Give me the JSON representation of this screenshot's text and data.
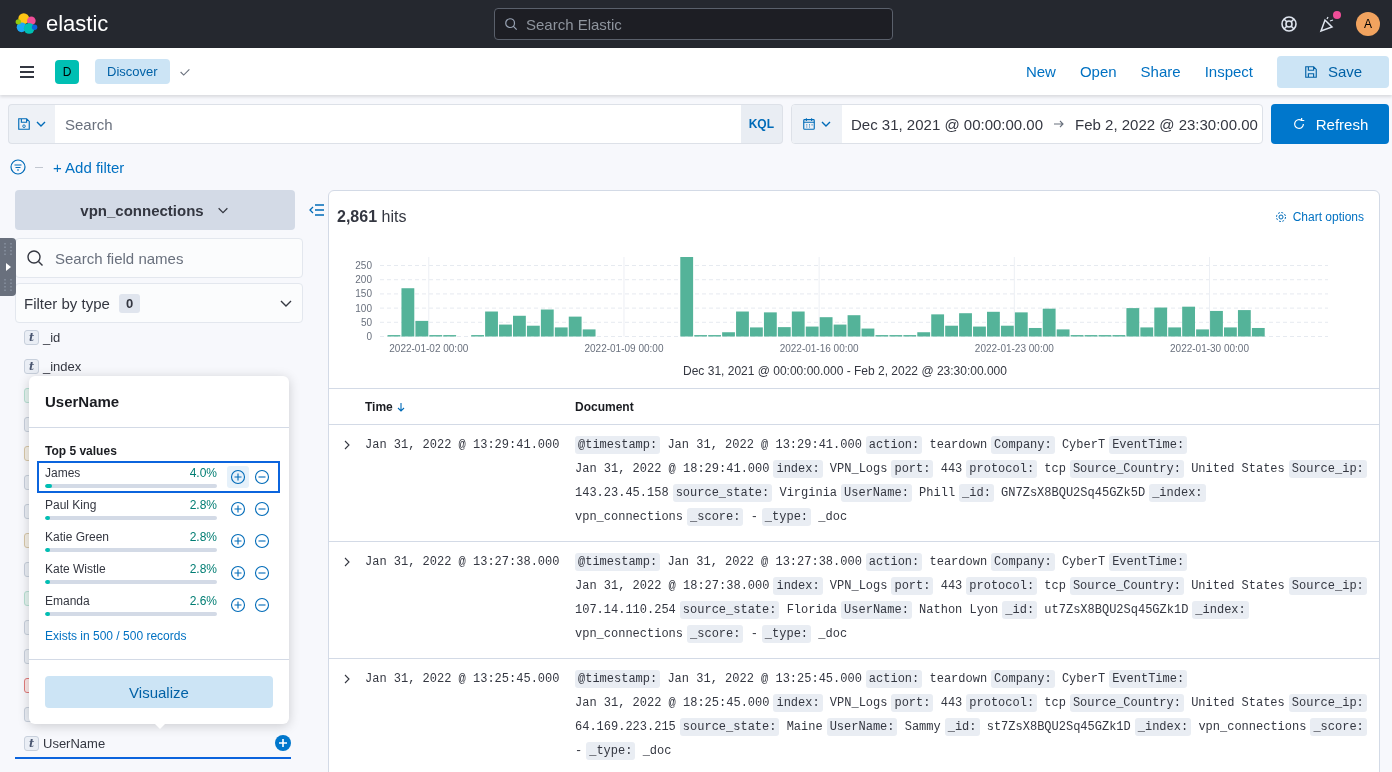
{
  "header": {
    "brand": "elastic",
    "search_placeholder": "Search Elastic",
    "notification": true,
    "avatar": "A"
  },
  "app_bar": {
    "space": "D",
    "breadcrumb": "Discover",
    "links": [
      "New",
      "Open",
      "Share",
      "Inspect"
    ],
    "save": "Save"
  },
  "query_bar": {
    "placeholder": "Search",
    "language": "KQL",
    "start": "Dec 31, 2021 @ 00:00:00.00",
    "end": "Feb 2, 2022 @ 23:30:00.00",
    "refresh": "Refresh"
  },
  "filter_bar": {
    "add_filter": "+ Add filter"
  },
  "sidebar": {
    "index_pattern": "vpn_connections",
    "field_search_placeholder": "Search field names",
    "filter_by_type": "Filter by type",
    "filter_count": "0",
    "fields": [
      {
        "kind": "string",
        "glyph": "t",
        "name": "_id",
        "selected": false
      },
      {
        "kind": "string",
        "glyph": "t",
        "name": "_index",
        "selected": false
      },
      {
        "kind": "number",
        "selected": false
      },
      {
        "kind": "string",
        "selected": false
      },
      {
        "kind": "date",
        "selected": false
      },
      {
        "kind": "string",
        "selected": false
      },
      {
        "kind": "string",
        "selected": false
      },
      {
        "kind": "date",
        "selected": false
      },
      {
        "kind": "string",
        "selected": false
      },
      {
        "kind": "number",
        "selected": false
      },
      {
        "kind": "string",
        "selected": false
      },
      {
        "kind": "string",
        "selected": false
      },
      {
        "kind": "ip",
        "selected": false
      },
      {
        "kind": "string",
        "selected": false
      },
      {
        "kind": "string",
        "glyph": "t",
        "name": "UserName",
        "selected": true
      }
    ]
  },
  "popover": {
    "title": "UserName",
    "subtitle": "Top 5 values",
    "values": [
      {
        "name": "James",
        "percent": "4.0%",
        "level": 0.04,
        "selected": true
      },
      {
        "name": "Paul King",
        "percent": "2.8%",
        "level": 0.028,
        "selected": false
      },
      {
        "name": "Katie Green",
        "percent": "2.8%",
        "level": 0.028,
        "selected": false
      },
      {
        "name": "Kate Wistle",
        "percent": "2.8%",
        "level": 0.028,
        "selected": false
      },
      {
        "name": "Emanda",
        "percent": "2.6%",
        "level": 0.026,
        "selected": false
      }
    ],
    "exists": "Exists in 500 / 500 records",
    "visualize": "Visualize"
  },
  "results": {
    "hits_count": "2,861",
    "hits_label": "hits",
    "chart_options": "Chart options",
    "chart_data": {
      "type": "bar",
      "categories": [
        null,
        null,
        null,
        "2022-01-02 00:00",
        null,
        null,
        null,
        null,
        null,
        null,
        null,
        null,
        null,
        null,
        null,
        null,
        null,
        "2022-01-09 00:00",
        null,
        null,
        null,
        null,
        null,
        null,
        null,
        null,
        null,
        null,
        null,
        null,
        null,
        "2022-01-16 00:00",
        null,
        null,
        null,
        null,
        null,
        null,
        null,
        null,
        null,
        null,
        null,
        null,
        null,
        "2022-01-23 00:00",
        null,
        null,
        null,
        null,
        null,
        null,
        null,
        null,
        null,
        null,
        null,
        null,
        null,
        "2022-01-30 00:00",
        null,
        null,
        null
      ],
      "series": [
        {
          "color": "#54b399",
          "values": [
            5,
            170,
            55,
            5,
            5,
            0,
            5,
            88,
            42,
            73,
            38,
            95,
            32,
            70,
            25,
            0,
            0,
            0,
            0,
            0,
            0,
            280,
            5,
            5,
            15,
            88,
            32,
            85,
            33,
            88,
            35,
            68,
            42,
            75,
            28,
            5,
            5,
            5,
            15,
            78,
            38,
            82,
            35,
            87,
            38,
            85,
            30,
            98,
            25,
            5,
            5,
            5,
            5,
            100,
            32,
            102,
            32,
            105,
            25,
            90,
            32,
            93,
            30
          ]
        }
      ],
      "ylim": [
        0,
        280
      ],
      "grid": true,
      "yticks": [
        0,
        50,
        100,
        150,
        200,
        250
      ]
    },
    "range": "Dec 31, 2021 @ 00:00:00.000 - Feb 2, 2022 @ 23:30:00.000",
    "columns": [
      "Time",
      "Document"
    ],
    "rows": [
      {
        "time": "Jan 31, 2022 @ 13:29:41.000",
        "fields": [
          {
            "key": "@timestamp:",
            "value": "Jan 31, 2022 @ 13:29:41.000"
          },
          {
            "key": "action:",
            "value": "teardown"
          },
          {
            "key": "Company:",
            "value": "CyberT"
          },
          {
            "key": "EventTime:",
            "value": "Jan 31, 2022 @ 18:29:41.000"
          },
          {
            "key": "index:",
            "value": "VPN_Logs"
          },
          {
            "key": "port:",
            "value": "443"
          },
          {
            "key": "protocol:",
            "value": "tcp"
          },
          {
            "key": "Source_Country:",
            "value": "United States"
          },
          {
            "key": "Source_ip:",
            "value": "143.23.45.158"
          },
          {
            "key": "source_state:",
            "value": "Virginia"
          },
          {
            "key": "UserName:",
            "value": "Phill"
          },
          {
            "key": "_id:",
            "value": "GN7ZsX8BQU2Sq45GZk5D"
          },
          {
            "key": "_index:",
            "value": "vpn_connections"
          },
          {
            "key": "_score:",
            "value": "-"
          },
          {
            "key": "_type:",
            "value": "_doc"
          }
        ]
      },
      {
        "time": "Jan 31, 2022 @ 13:27:38.000",
        "fields": [
          {
            "key": "@timestamp:",
            "value": "Jan 31, 2022 @ 13:27:38.000"
          },
          {
            "key": "action:",
            "value": "teardown"
          },
          {
            "key": "Company:",
            "value": "CyberT"
          },
          {
            "key": "EventTime:",
            "value": "Jan 31, 2022 @ 18:27:38.000"
          },
          {
            "key": "index:",
            "value": "VPN_Logs"
          },
          {
            "key": "port:",
            "value": "443"
          },
          {
            "key": "protocol:",
            "value": "tcp"
          },
          {
            "key": "Source_Country:",
            "value": "United States"
          },
          {
            "key": "Source_ip:",
            "value": "107.14.110.254"
          },
          {
            "key": "source_state:",
            "value": "Florida"
          },
          {
            "key": "UserName:",
            "value": "Nathon Lyon"
          },
          {
            "key": "_id:",
            "value": "ut7ZsX8BQU2Sq45GZk1D"
          },
          {
            "key": "_index:",
            "value": "vpn_connections"
          },
          {
            "key": "_score:",
            "value": "-"
          },
          {
            "key": "_type:",
            "value": "_doc"
          }
        ]
      },
      {
        "time": "Jan 31, 2022 @ 13:25:45.000",
        "fields": [
          {
            "key": "@timestamp:",
            "value": "Jan 31, 2022 @ 13:25:45.000"
          },
          {
            "key": "action:",
            "value": "teardown"
          },
          {
            "key": "Company:",
            "value": "CyberT"
          },
          {
            "key": "EventTime:",
            "value": "Jan 31, 2022 @ 18:25:45.000"
          },
          {
            "key": "index:",
            "value": "VPN_Logs"
          },
          {
            "key": "port:",
            "value": "443"
          },
          {
            "key": "protocol:",
            "value": "tcp"
          },
          {
            "key": "Source_Country:",
            "value": "United States"
          },
          {
            "key": "Source_ip:",
            "value": "64.169.223.215"
          },
          {
            "key": "source_state:",
            "value": "Maine"
          },
          {
            "key": "UserName:",
            "value": "Sammy"
          },
          {
            "key": "_id:",
            "value": "st7ZsX8BQU2Sq45GZk1D"
          },
          {
            "key": "_index:",
            "value": "vpn_connections"
          },
          {
            "key": "_score:",
            "value": "-"
          },
          {
            "key": "_type:",
            "value": "_doc"
          }
        ]
      }
    ]
  }
}
